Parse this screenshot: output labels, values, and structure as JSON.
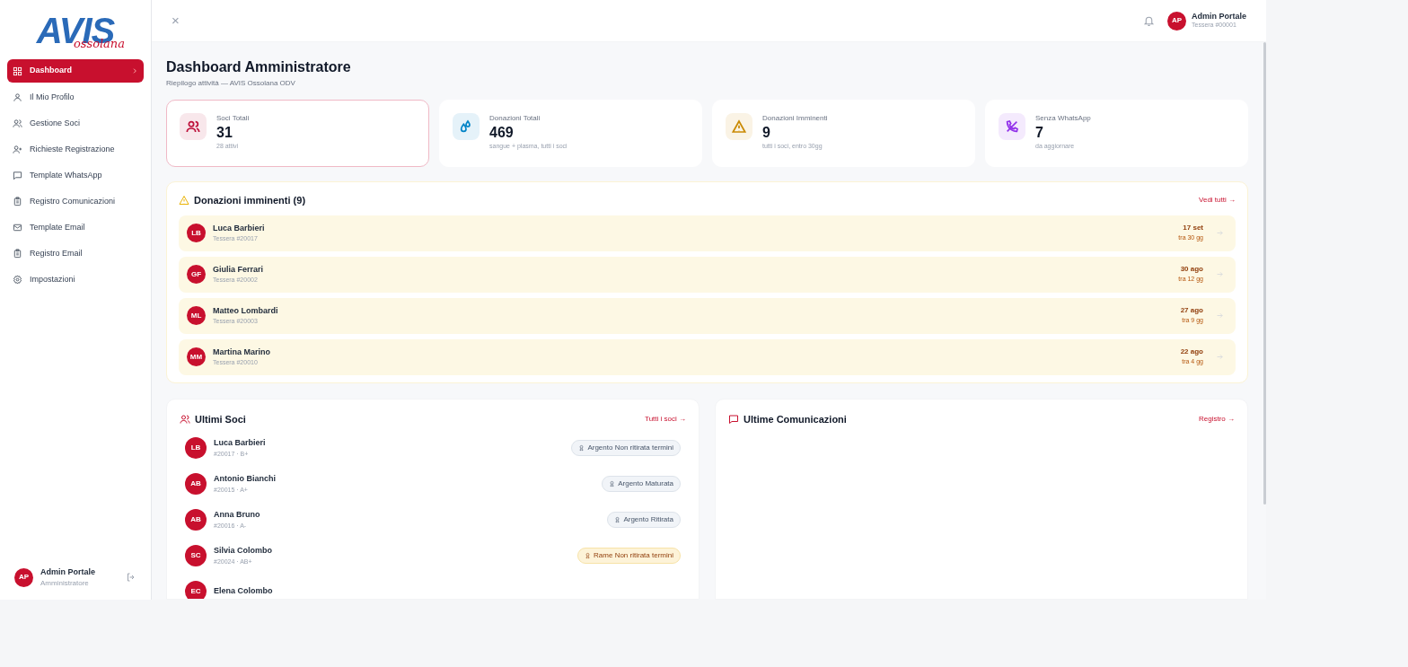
{
  "logo": {
    "main": "AVIS",
    "sub": "ossolana"
  },
  "sidebar": {
    "items": [
      {
        "label": "Dashboard",
        "selected": true
      },
      {
        "label": "Il Mio Profilo",
        "selected": false
      },
      {
        "label": "Gestione Soci",
        "selected": false
      },
      {
        "label": "Richieste Registrazione",
        "selected": false
      },
      {
        "label": "Template WhatsApp",
        "selected": false
      },
      {
        "label": "Registro Comunicazioni",
        "selected": false
      },
      {
        "label": "Template Email",
        "selected": false
      },
      {
        "label": "Registro Email",
        "selected": false
      },
      {
        "label": "Impostazioni",
        "selected": false
      }
    ],
    "user": {
      "initials": "AP",
      "name": "Admin Portale",
      "role": "Amministratore"
    }
  },
  "topbar": {
    "close": "×",
    "user": {
      "initials": "AP",
      "name": "Admin Portale",
      "card": "Tessera #00001"
    }
  },
  "page": {
    "title": "Dashboard Amministratore",
    "subtitle": "Riepilogo attività — AVIS Ossolana ODV"
  },
  "stats": [
    {
      "label": "Soci Totali",
      "value": "31",
      "note": "28 attivi",
      "color": "#be123c",
      "selected": true
    },
    {
      "label": "Donazioni Totali",
      "value": "469",
      "note": "sangue + plasma, tutti i soci",
      "color": "#0284c7",
      "selected": false
    },
    {
      "label": "Donazioni Imminenti",
      "value": "9",
      "note": "tutti i soci, entro 30gg",
      "color": "#ca8a04",
      "selected": false
    },
    {
      "label": "Senza WhatsApp",
      "value": "7",
      "note": "da aggiornare",
      "color": "#9333ea",
      "selected": false
    }
  ],
  "upcoming": {
    "title": "Donazioni imminenti (9)",
    "link": "Vedi tutti →",
    "rows": [
      {
        "initials": "LB",
        "name": "Luca Barbieri",
        "card": "Tessera #20017",
        "date": "17 set",
        "in": "tra 30 gg"
      },
      {
        "initials": "GF",
        "name": "Giulia Ferrari",
        "card": "Tessera #20002",
        "date": "30 ago",
        "in": "tra 12 gg"
      },
      {
        "initials": "ML",
        "name": "Matteo Lombardi",
        "card": "Tessera #20003",
        "date": "27 ago",
        "in": "tra 9 gg"
      },
      {
        "initials": "MM",
        "name": "Martina Marino",
        "card": "Tessera #20010",
        "date": "22 ago",
        "in": "tra 4 gg"
      }
    ]
  },
  "latest_members": {
    "title": "Ultimi Soci",
    "link": "Tutti i soci →",
    "rows": [
      {
        "initials": "LB",
        "name": "Luca Barbieri",
        "meta": "#20017 · B+",
        "badge": "Argento Non ritirata termini",
        "kind": "argento"
      },
      {
        "initials": "AB",
        "name": "Antonio Bianchi",
        "meta": "#20015 · A+",
        "badge": "Argento Maturata",
        "kind": "argento"
      },
      {
        "initials": "AB",
        "name": "Anna Bruno",
        "meta": "#20016 · A-",
        "badge": "Argento Ritirata",
        "kind": "argento"
      },
      {
        "initials": "SC",
        "name": "Silvia Colombo",
        "meta": "#20024 · AB+",
        "badge": "Rame Non ritirata termini",
        "kind": "rame"
      },
      {
        "initials": "EC",
        "name": "Elena Colombo"
      }
    ]
  },
  "latest_comms": {
    "title": "Ultime Comunicazioni",
    "link": "Registro →"
  }
}
